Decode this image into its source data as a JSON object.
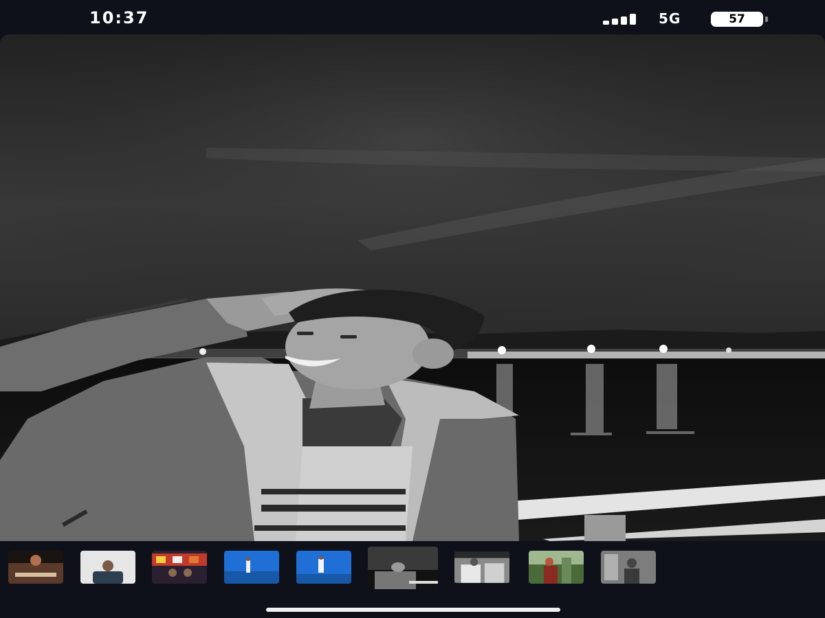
{
  "status_bar": {
    "time": "10:37",
    "network": "5G",
    "battery_level": "57",
    "signal_icon": "cellular-signal-icon",
    "battery_icon": "battery-icon"
  },
  "photo": {
    "subject": "black-and-white-photo",
    "tone": "monochrome"
  },
  "thumbnails": {
    "count": 9,
    "selected_index": 5,
    "items": [
      {
        "name": "thumbnail-1",
        "accent": "#5a3a2a"
      },
      {
        "name": "thumbnail-2",
        "accent": "#cfcfcf"
      },
      {
        "name": "thumbnail-3",
        "accent": "#c23a2a"
      },
      {
        "name": "thumbnail-4",
        "accent": "#1f6fd6"
      },
      {
        "name": "thumbnail-5",
        "accent": "#1f6fd6"
      },
      {
        "name": "thumbnail-6",
        "accent": "#555555"
      },
      {
        "name": "thumbnail-7",
        "accent": "#8a8a8a"
      },
      {
        "name": "thumbnail-8",
        "accent": "#b8553a"
      },
      {
        "name": "thumbnail-9",
        "accent": "#6a6a6a"
      }
    ]
  }
}
